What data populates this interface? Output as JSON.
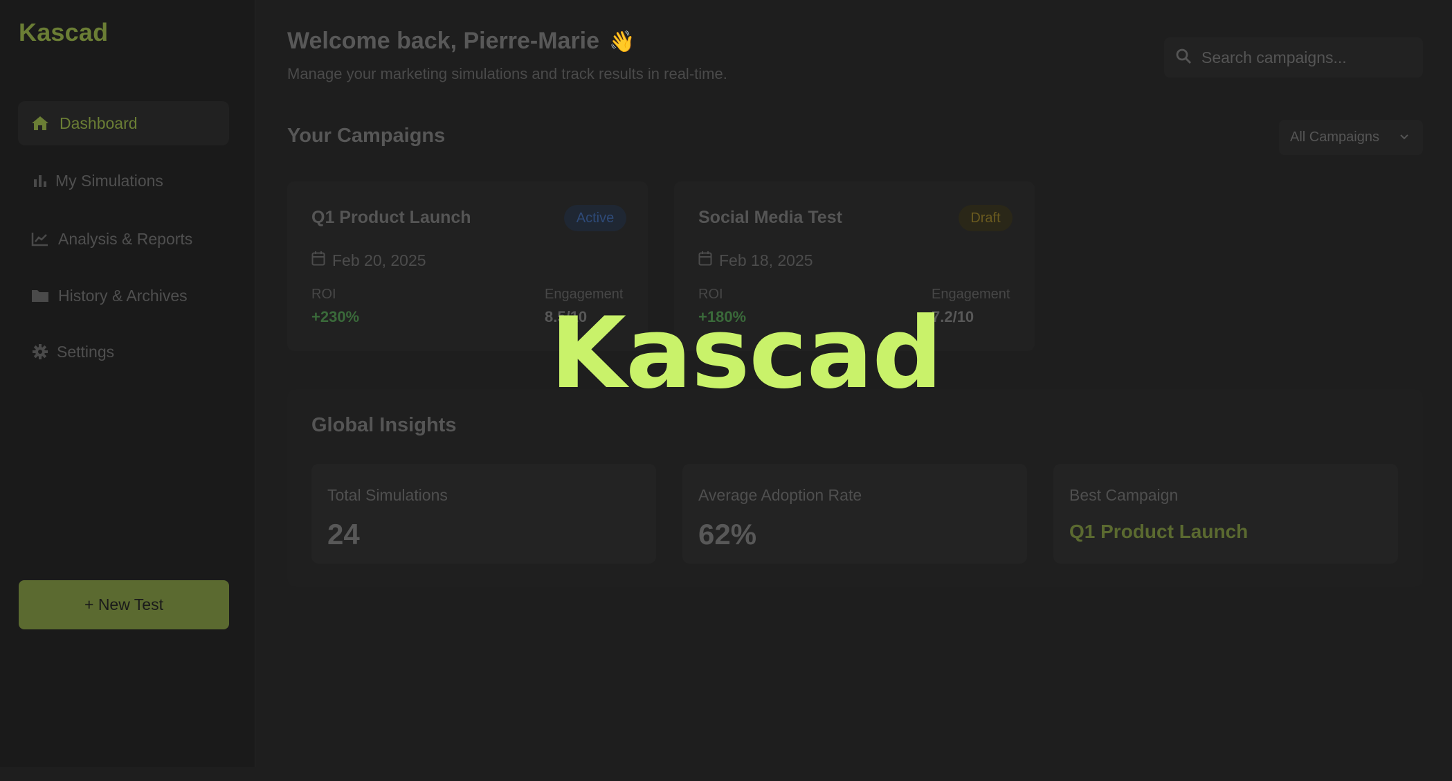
{
  "app": {
    "logo": "Kascad"
  },
  "sidebar": {
    "items": [
      {
        "label": "Dashboard",
        "icon": "home-icon",
        "active": true
      },
      {
        "label": "My Simulations",
        "icon": "bar-chart-icon",
        "active": false
      },
      {
        "label": "Analysis & Reports",
        "icon": "line-chart-icon",
        "active": false
      },
      {
        "label": "History & Archives",
        "icon": "folder-icon",
        "active": false
      },
      {
        "label": "Settings",
        "icon": "gear-icon",
        "active": false
      }
    ],
    "new_test_label": "+ New Test"
  },
  "header": {
    "welcome": "Welcome back, Pierre-Marie",
    "wave": "👋",
    "subtitle": "Manage your marketing simulations and track results in real-time.",
    "search_placeholder": "Search campaigns..."
  },
  "campaigns": {
    "title": "Your Campaigns",
    "filter_label": "All Campaigns",
    "cards": [
      {
        "title": "Q1 Product Launch",
        "status": "Active",
        "date": "Feb 20, 2025",
        "roi_label": "ROI",
        "roi": "+230%",
        "engagement_label": "Engagement",
        "engagement": "8.5/10"
      },
      {
        "title": "Social Media Test",
        "status": "Draft",
        "date": "Feb 18, 2025",
        "roi_label": "ROI",
        "roi": "+180%",
        "engagement_label": "Engagement",
        "engagement": "7.2/10"
      }
    ]
  },
  "insights": {
    "title": "Global Insights",
    "stats": [
      {
        "label": "Total Simulations",
        "value": "24"
      },
      {
        "label": "Average Adoption Rate",
        "value": "62%"
      },
      {
        "label": "Best Campaign",
        "value": "Q1 Product Launch"
      }
    ]
  },
  "overlay": {
    "brand": "Kascad"
  },
  "colors": {
    "accent": "#6b7e35",
    "brand_overlay": "#c9f26a",
    "background": "#1e1e1e"
  }
}
